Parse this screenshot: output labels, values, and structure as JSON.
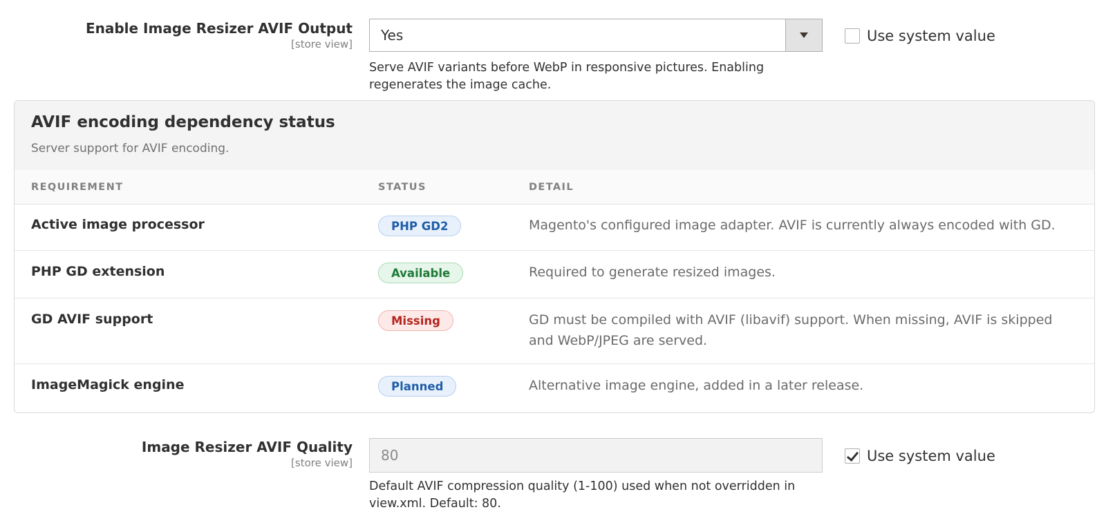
{
  "avif_output": {
    "label": "Enable Image Resizer AVIF Output",
    "scope": "[store view]",
    "selected_value": "Yes",
    "use_system_label": "Use system value",
    "use_system_checked": false,
    "note": "Serve AVIF variants before WebP in responsive pictures. Enabling regenerates the image cache."
  },
  "dependency_panel": {
    "title": "AVIF encoding dependency status",
    "subtitle": "Server support for AVIF encoding.",
    "columns": [
      "REQUIREMENT",
      "STATUS",
      "DETAIL"
    ],
    "rows": [
      {
        "requirement": "Active image processor",
        "status": "PHP GD2",
        "status_type": "info",
        "detail": "Magento's configured image adapter. AVIF is currently always encoded with GD."
      },
      {
        "requirement": "PHP GD extension",
        "status": "Available",
        "status_type": "ok",
        "detail": "Required to generate resized images."
      },
      {
        "requirement": "GD AVIF support",
        "status": "Missing",
        "status_type": "bad",
        "detail": "GD must be compiled with AVIF (libavif) support. When missing, AVIF is skipped and WebP/JPEG are served."
      },
      {
        "requirement": "ImageMagick engine",
        "status": "Planned",
        "status_type": "info",
        "detail": "Alternative image engine, added in a later release."
      }
    ]
  },
  "avif_quality": {
    "label": "Image Resizer AVIF Quality",
    "scope": "[store view]",
    "value": "80",
    "use_system_label": "Use system value",
    "use_system_checked": true,
    "note": "Default AVIF compression quality (1-100) used when not overridden in view.xml. Default: 80."
  },
  "colors": {
    "info_badge": "#1f5da8",
    "ok_badge": "#1f7a39",
    "bad_badge": "#b3261e"
  },
  "icons": {
    "dropdown": "chevron-down-icon",
    "checkbox_checked": "checkmark-icon"
  }
}
